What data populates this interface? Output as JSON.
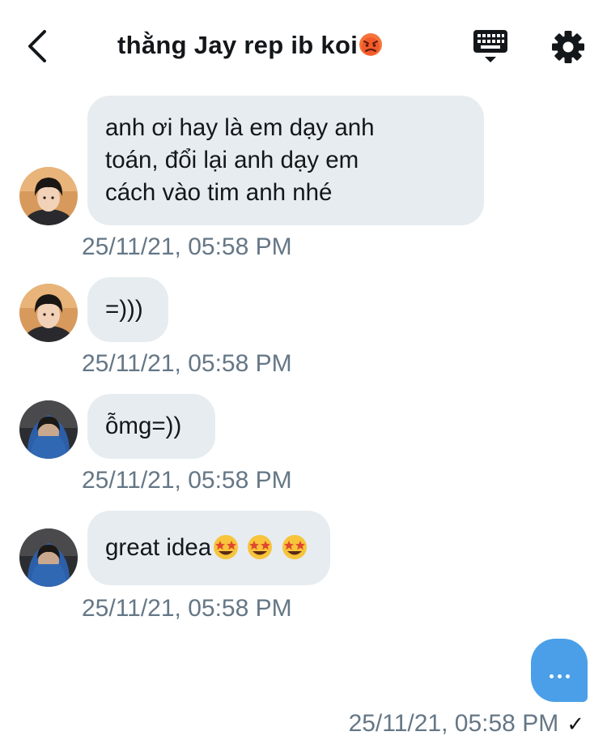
{
  "header": {
    "title": "thằng Jay rep ib koi",
    "back_icon": "chevron-left-icon",
    "keyboard_icon": "keyboard-icon",
    "settings_icon": "gear-icon"
  },
  "messages": [
    {
      "sender": "contact-a",
      "text": "anh ơi hay là em dạy anh\ntoán, đổi lại anh dạy em\ncách vào tim anh nhé",
      "timestamp": "25/11/21, 05:58 PM"
    },
    {
      "sender": "contact-a",
      "text": "=)))",
      "timestamp": "25/11/21, 05:58 PM"
    },
    {
      "sender": "contact-b",
      "text": "ỗmg=))",
      "timestamp": "25/11/21, 05:58 PM"
    },
    {
      "sender": "contact-b",
      "text": "great idea",
      "emoji": "star-struck x3",
      "timestamp": "25/11/21, 05:58 PM"
    }
  ],
  "sent": {
    "typing": "...",
    "timestamp": "25/11/21, 05:58 PM",
    "status": "✓"
  },
  "colors": {
    "incoming_bubble": "#e6ecf0",
    "outgoing_bubble": "#4a9fe8",
    "timestamp": "#657786",
    "text": "#14171a"
  }
}
